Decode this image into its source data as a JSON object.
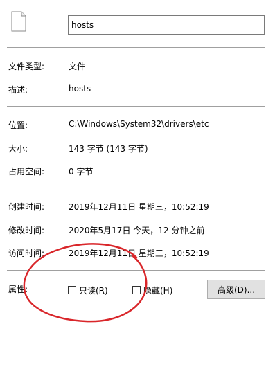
{
  "file": {
    "icon": "document-icon",
    "name": "hosts"
  },
  "properties": {
    "type_label": "文件类型:",
    "type_value": "文件",
    "desc_label": "描述:",
    "desc_value": "hosts",
    "location_label": "位置:",
    "location_value": "C:\\Windows\\System32\\drivers\\etc",
    "size_label": "大小:",
    "size_value": "143 字节 (143 字节)",
    "size_on_disk_label": "占用空间:",
    "size_on_disk_value": "0 字节",
    "created_label": "创建时间:",
    "created_value": "2019年12月11日 星期三，10:52:19",
    "modified_label": "修改时间:",
    "modified_value": "2020年5月17日 今天，12 分钟之前",
    "accessed_label": "访问时间:",
    "accessed_value": "2019年12月11日 星期三，10:52:19"
  },
  "attributes": {
    "label": "属性:",
    "readonly_label": "只读(R)",
    "readonly_checked": false,
    "hidden_label": "隐藏(H)",
    "hidden_checked": false,
    "advanced_label": "高级(D)..."
  },
  "annotation": {
    "color": "#d9262a",
    "shape": "hand-drawn-ellipse"
  }
}
